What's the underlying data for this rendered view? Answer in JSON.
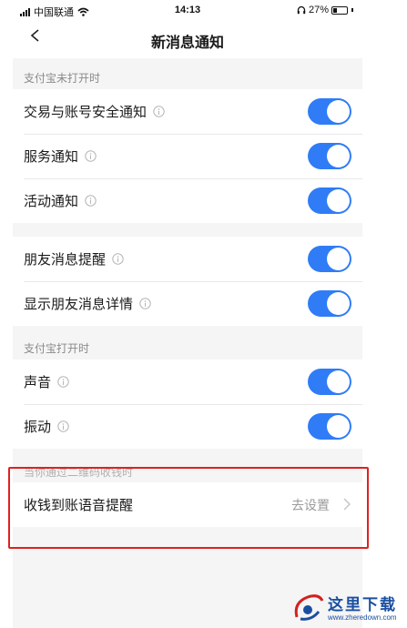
{
  "status_bar": {
    "carrier": "中国联通",
    "time": "14:13",
    "battery": "27%",
    "battery_level": 0.27
  },
  "nav": {
    "title": "新消息通知",
    "back_icon": "chevron-left-icon"
  },
  "sections": [
    {
      "header": "支付宝未打开时",
      "rows": [
        {
          "label": "交易与账号安全通知",
          "enabled": true
        },
        {
          "label": "服务通知",
          "enabled": true
        },
        {
          "label": "活动通知",
          "enabled": true
        }
      ]
    },
    {
      "header": "",
      "rows": [
        {
          "label": "朋友消息提醒",
          "enabled": true
        },
        {
          "label": "显示朋友消息详情",
          "enabled": true
        }
      ]
    },
    {
      "header": "支付宝打开时",
      "rows": [
        {
          "label": "声音",
          "enabled": true
        },
        {
          "label": "振动",
          "enabled": true
        }
      ]
    },
    {
      "header": "当你通过二维码收钱时",
      "rows": [
        {
          "label": "收钱到账语音提醒",
          "value": "去设置"
        }
      ]
    }
  ],
  "watermark": {
    "title": "这里下载",
    "url": "www.zheredown.com"
  },
  "colors": {
    "toggle_on": "#2f7cf6",
    "highlight": "#e02020",
    "background": "#f5f5f5"
  }
}
